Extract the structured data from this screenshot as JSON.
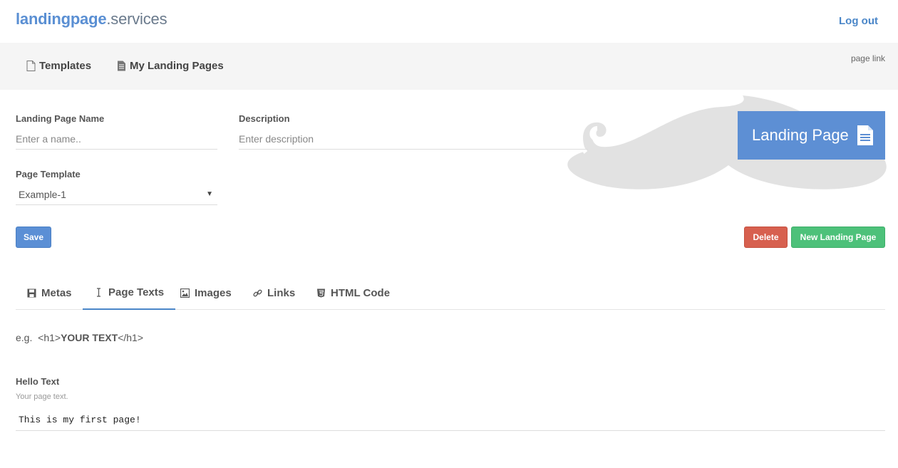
{
  "header": {
    "brand_main": "landingpage",
    "brand_suffix": ".services",
    "logout_label": "Log out"
  },
  "nav": {
    "items": [
      {
        "label": "Templates",
        "icon": "file-icon"
      },
      {
        "label": "My Landing Pages",
        "icon": "file-text-icon"
      }
    ],
    "page_link_label": "page link"
  },
  "form": {
    "name_label": "Landing Page Name",
    "name_placeholder": "Enter a name..",
    "description_label": "Description",
    "description_placeholder": "Enter description",
    "template_label": "Page Template",
    "template_value": "Example-1"
  },
  "badge": {
    "label": "Landing Page",
    "icon": "document-icon"
  },
  "buttons": {
    "save": "Save",
    "delete": "Delete",
    "new_page": "New Landing Page"
  },
  "tabs": [
    {
      "label": "Metas",
      "icon": "save-icon",
      "active": false
    },
    {
      "label": "Page Texts",
      "icon": "text-cursor-icon",
      "active": true
    },
    {
      "label": "Images",
      "icon": "image-icon",
      "active": false
    },
    {
      "label": "Links",
      "icon": "link-icon",
      "active": false
    },
    {
      "label": "HTML Code",
      "icon": "html5-icon",
      "active": false
    }
  ],
  "example": {
    "prefix": "e.g.",
    "open_tag": "<h1>",
    "bold_text": "YOUR TEXT",
    "close_tag": "</h1>"
  },
  "text_field": {
    "label": "Hello Text",
    "help": "Your page text.",
    "value": "This is my first page!"
  },
  "colors": {
    "brand_blue": "#5a8fd3",
    "save_blue": "#5b8fd5",
    "delete_red": "#d7604f",
    "new_green": "#4dc17a",
    "active_tab": "#4a86c8",
    "navbar_bg": "#f5f5f5"
  }
}
